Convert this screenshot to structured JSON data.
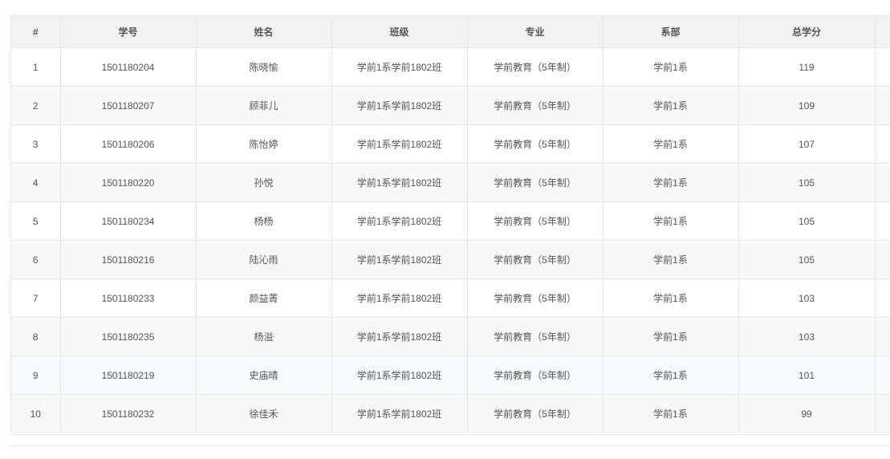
{
  "table": {
    "headers": [
      "#",
      "学号",
      "姓名",
      "班级",
      "专业",
      "系部",
      "总学分"
    ],
    "rows": [
      [
        "1",
        "1501180204",
        "陈晓愉",
        "学前1系学前1802班",
        "学前教育（5年制）",
        "学前1系",
        "119"
      ],
      [
        "2",
        "1501180207",
        "顾菲儿",
        "学前1系学前1802班",
        "学前教育（5年制）",
        "学前1系",
        "109"
      ],
      [
        "3",
        "1501180206",
        "陈怡婷",
        "学前1系学前1802班",
        "学前教育（5年制）",
        "学前1系",
        "107"
      ],
      [
        "4",
        "1501180220",
        "孙悦",
        "学前1系学前1802班",
        "学前教育（5年制）",
        "学前1系",
        "105"
      ],
      [
        "5",
        "1501180234",
        "杨杨",
        "学前1系学前1802班",
        "学前教育（5年制）",
        "学前1系",
        "105"
      ],
      [
        "6",
        "1501180216",
        "陆沁雨",
        "学前1系学前1802班",
        "学前教育（5年制）",
        "学前1系",
        "105"
      ],
      [
        "7",
        "1501180233",
        "颜益菁",
        "学前1系学前1802班",
        "学前教育（5年制）",
        "学前1系",
        "103"
      ],
      [
        "8",
        "1501180235",
        "杨溢",
        "学前1系学前1802班",
        "学前教育（5年制）",
        "学前1系",
        "103"
      ],
      [
        "9",
        "1501180219",
        "史庙晴",
        "学前1系学前1802班",
        "学前教育（5年制）",
        "学前1系",
        "101"
      ],
      [
        "10",
        "1501180232",
        "徐佳禾",
        "学前1系学前1802班",
        "学前教育（5年制）",
        "学前1系",
        "99"
      ]
    ]
  },
  "colors": {
    "header_bg": "#f2f2f2",
    "stripe_bg": "#f8f8f8",
    "hover_bg": "#f5fafc",
    "border": "#e6e6e6",
    "text": "#555555"
  }
}
